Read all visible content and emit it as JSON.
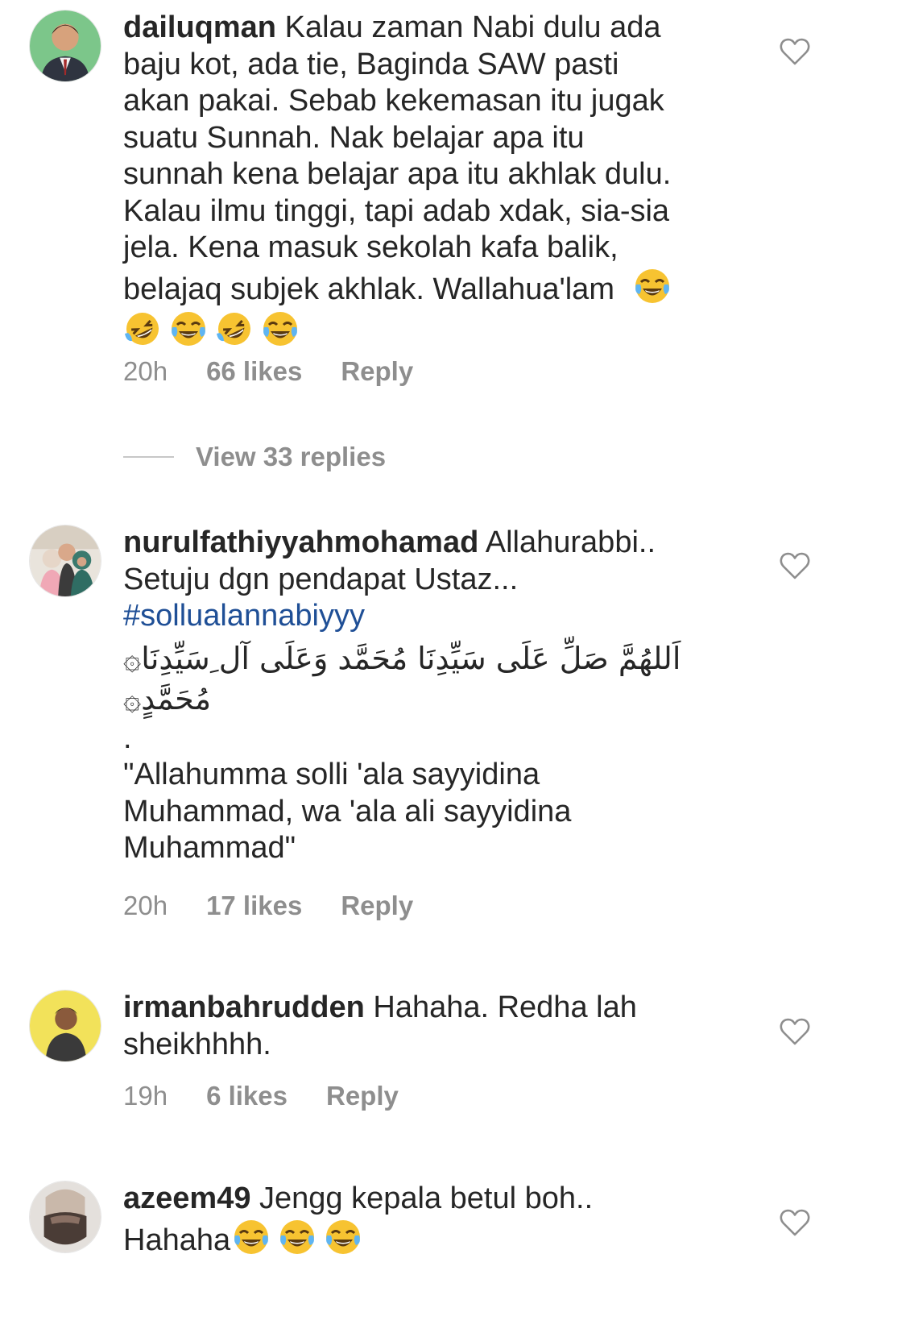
{
  "comments": [
    {
      "username": "dailuqman",
      "text_lines": [
        "Kalau zaman Nabi dulu ada",
        "baju kot, ada tie, Baginda SAW pasti",
        "akan pakai. Sebab kekemasan itu jugak",
        "suatu Sunnah. Nak belajar apa itu",
        "sunnah kena belajar apa itu akhlak dulu.",
        "Kalau ilmu tinggi, tapi adab xdak, sia-sia",
        "jela. Kena masuk sekolah kafa balik,",
        "belajaq subjek akhlak. Wallahua'lam"
      ],
      "time": "20h",
      "likes": "66 likes",
      "reply": "Reply",
      "emojis": [
        "face-with-tears-of-joy-icon",
        "rolling-on-floor-laughing-icon",
        "face-with-tears-of-joy-icon",
        "rolling-on-floor-laughing-icon",
        "face-with-tears-of-joy-icon"
      ]
    },
    {
      "username": "nurulfathiyyahmohamad",
      "text_first": "Allahurabbi..",
      "text_line2": "Setuju dgn pendapat Ustaz...",
      "hashtag": "#sollualannabiyyy",
      "arabic_line1": "اَللهُمَّ صَلِّ عَلَى سَيِّدِنَا مُحَمَّد وَعَلَى آل ِسَيِّدِنَا۞",
      "arabic_line2": "مُحَمَّدٍ۞",
      "dot": ".",
      "trans_line1": "\"Allahumma solli 'ala sayyidina",
      "trans_line2": "Muhammad, wa 'ala ali sayyidina",
      "trans_line3": "Muhammad\"",
      "time": "20h",
      "likes": "17 likes",
      "reply": "Reply"
    },
    {
      "username": "irmanbahrudden",
      "text_first": "Hahaha. Redha lah",
      "text_line2": "sheikhhhh.",
      "time": "19h",
      "likes": "6 likes",
      "reply": "Reply"
    },
    {
      "username": "azeem49",
      "text_first": "Jengg kepala betul boh..",
      "text_line2": "Hahaha"
    }
  ],
  "view_replies": "View 33 replies",
  "colors": {
    "text": "#262626",
    "meta": "#8e8e8e",
    "hashtag": "#1f4f96",
    "divider": "#c7c7c7"
  }
}
